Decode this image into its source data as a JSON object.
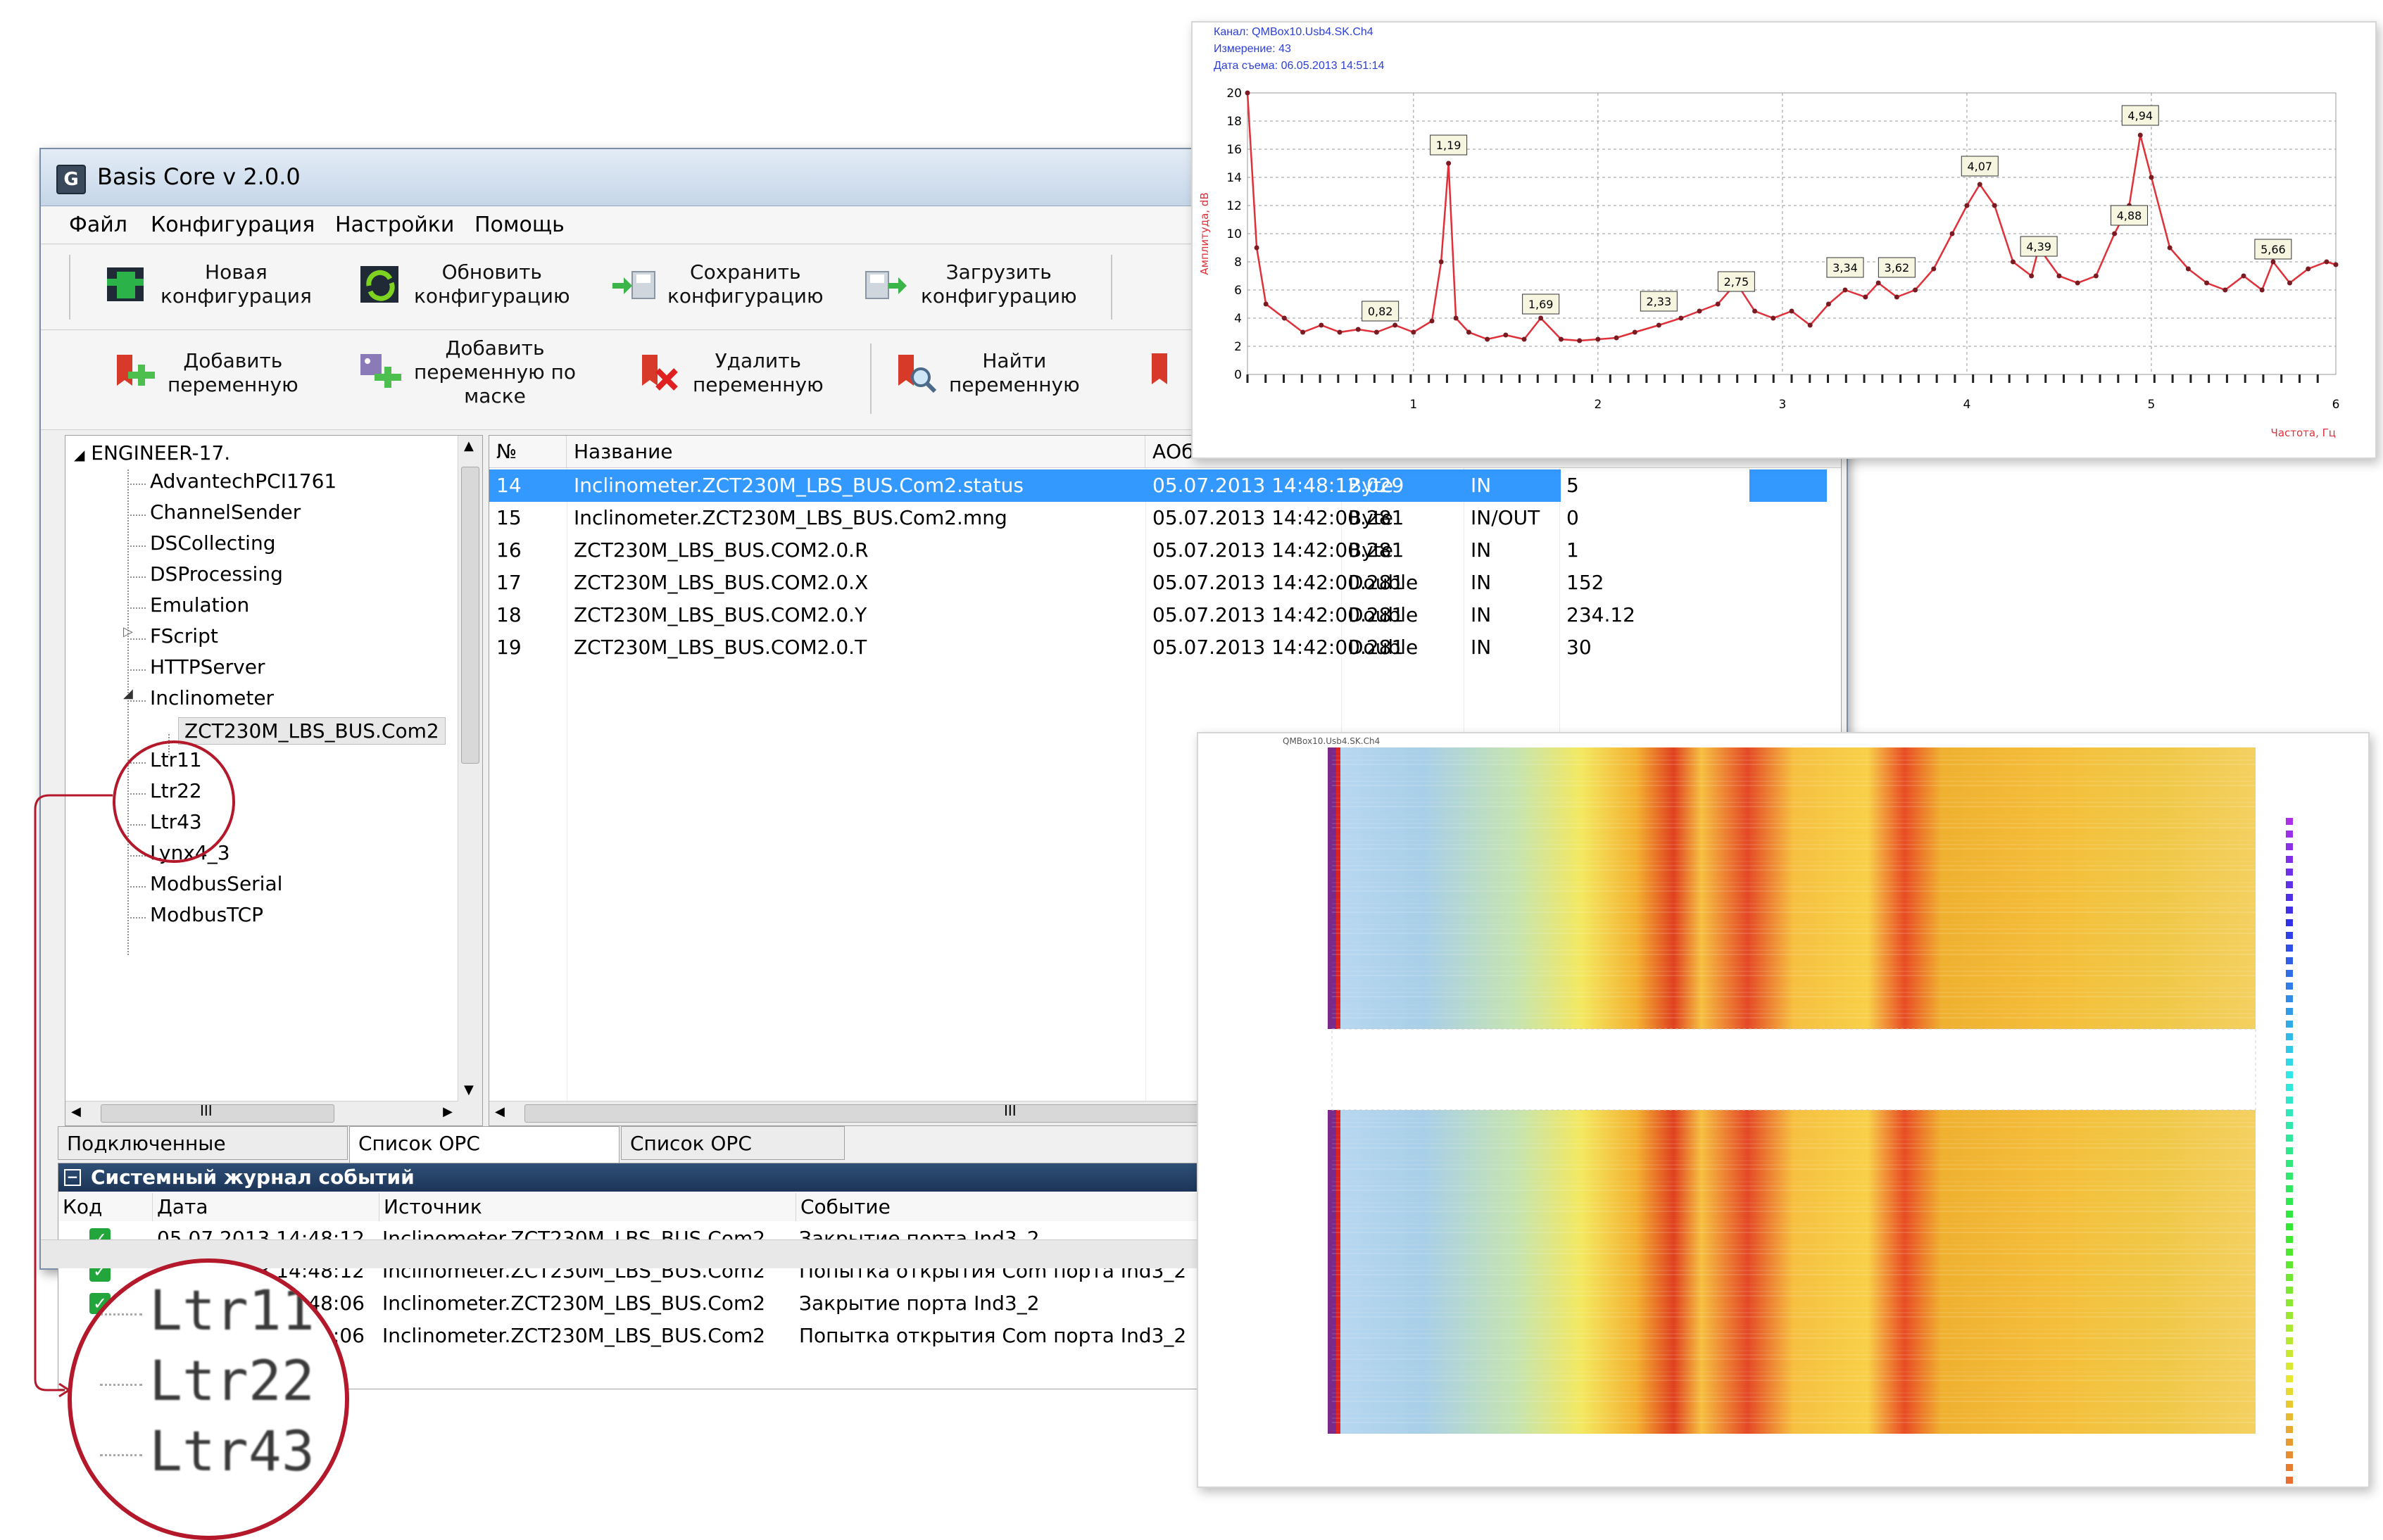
{
  "window": {
    "title": "Basis Core v 2.0.0",
    "icon_letter": "G"
  },
  "menu": [
    "Файл",
    "Конфигурация",
    "Настройки",
    "Помощь"
  ],
  "toolbar1": [
    {
      "label": "Новая\nконфигурация",
      "icon": "new-config-icon"
    },
    {
      "label": "Обновить\nконфигурацию",
      "icon": "refresh-config-icon"
    },
    {
      "label": "Сохранить\nконфигурацию",
      "icon": "save-config-icon"
    },
    {
      "label": "Загрузить\nконфигурацию",
      "icon": "load-config-icon"
    }
  ],
  "toolbar2": [
    {
      "label": "Добавить\nпеременную",
      "icon": "add-variable-icon"
    },
    {
      "label": "Добавить\nпеременную по\nмаске",
      "icon": "add-variable-mask-icon"
    },
    {
      "label": "Удалить\nпеременную",
      "icon": "delete-variable-icon"
    },
    {
      "label": "Найти\nпеременную",
      "icon": "find-variable-icon"
    }
  ],
  "tree": {
    "root": "ENGINEER-17.",
    "items": [
      "AdvantechPCI1761",
      "ChannelSender",
      "DSCollecting",
      "DSProcessing",
      "Emulation",
      "FScript",
      "HTTPServer",
      "Inclinometer",
      "Ltr11",
      "Ltr22",
      "Ltr43",
      "Lynx4_3",
      "ModbusSerial",
      "ModbusTCP"
    ],
    "selected_child": "ZCT230M_LBS_BUS.Com2",
    "hscroll_label": "III"
  },
  "grid": {
    "headers": [
      "№",
      "Название",
      "АОб"
    ],
    "rows": [
      {
        "n": "14",
        "name": "Inclinometer.ZCT230M_LBS_BUS.Com2.status",
        "date": "05.07.2013 14:48:12.029",
        "type": "Byte",
        "dir": "IN",
        "val": "5"
      },
      {
        "n": "15",
        "name": "Inclinometer.ZCT230M_LBS_BUS.Com2.mng",
        "date": "05.07.2013 14:42:00.281",
        "type": "Byte",
        "dir": "IN/OUT",
        "val": "0"
      },
      {
        "n": "16",
        "name": "ZCT230M_LBS_BUS.COM2.0.R",
        "date": "05.07.2013 14:42:00.281",
        "type": "Byte",
        "dir": "IN",
        "val": "1"
      },
      {
        "n": "17",
        "name": "ZCT230M_LBS_BUS.COM2.0.X",
        "date": "05.07.2013 14:42:00.281",
        "type": "Double",
        "dir": "IN",
        "val": "152"
      },
      {
        "n": "18",
        "name": "ZCT230M_LBS_BUS.COM2.0.Y",
        "date": "05.07.2013 14:42:00.281",
        "type": "Double",
        "dir": "IN",
        "val": "234.12"
      },
      {
        "n": "19",
        "name": "ZCT230M_LBS_BUS.COM2.0.T",
        "date": "05.07.2013 14:42:00.281",
        "type": "Double",
        "dir": "IN",
        "val": "30"
      }
    ],
    "hscroll_label": "III"
  },
  "tabs": [
    "Подключенные устройства",
    "Список ОРС переменных",
    "Список ОРС клиентов"
  ],
  "log": {
    "title": "Системный журнал событий",
    "headers": [
      "Код",
      "Дата",
      "Источник",
      "Событие"
    ],
    "rows": [
      {
        "date": "05.07.2013 14:48:12",
        "source": "Inclinometer.ZCT230M_LBS_BUS.Com2",
        "event": "Закрытие порта Ind3_2"
      },
      {
        "date": "05.07.2013 14:48:12",
        "source": "Inclinometer.ZCT230M_LBS_BUS.Com2",
        "event": "Попытка открытия Com порта Ind3_2"
      },
      {
        "date": "05.07.2013 14:48:06",
        "source": "Inclinometer.ZCT230M_LBS_BUS.Com2",
        "event": "Закрытие порта Ind3_2"
      },
      {
        "date": "05.07.2013 14:48:06",
        "source": "Inclinometer.ZCT230M_LBS_BUS.Com2",
        "event": "Попытка открытия Com порта Ind3_2"
      }
    ]
  },
  "zoom": {
    "items": [
      "Ltr11",
      "Ltr22",
      "Ltr43"
    ]
  },
  "chart_data": {
    "type": "line",
    "header": [
      "Канал: QMBox10.Usb4.SK.Ch4",
      "Измерение: 43",
      "Дата съема: 06.05.2013 14:51:14"
    ],
    "ylabel": "Амплитуда, dB",
    "xlabel": "Частота, Гц",
    "xlim": [
      0.1,
      6
    ],
    "ylim": [
      0,
      20
    ],
    "xticks": [
      1,
      2,
      3,
      4,
      5,
      6
    ],
    "yticks": [
      0,
      2,
      4,
      6,
      8,
      10,
      12,
      14,
      16,
      18,
      20
    ],
    "color": "#e0303a",
    "x": [
      0.1,
      0.15,
      0.2,
      0.3,
      0.4,
      0.5,
      0.6,
      0.7,
      0.8,
      0.9,
      1.0,
      1.1,
      1.15,
      1.19,
      1.23,
      1.3,
      1.4,
      1.5,
      1.6,
      1.69,
      1.8,
      1.9,
      2.0,
      2.1,
      2.2,
      2.33,
      2.45,
      2.55,
      2.65,
      2.75,
      2.85,
      2.95,
      3.05,
      3.15,
      3.25,
      3.34,
      3.45,
      3.52,
      3.62,
      3.72,
      3.82,
      3.92,
      4.0,
      4.07,
      4.15,
      4.25,
      4.35,
      4.39,
      4.5,
      4.6,
      4.7,
      4.8,
      4.88,
      4.94,
      5.0,
      5.1,
      5.2,
      5.3,
      5.4,
      5.5,
      5.6,
      5.66,
      5.75,
      5.85,
      5.95,
      6.0
    ],
    "values": [
      20,
      9,
      5,
      4,
      3,
      3.5,
      3,
      3.2,
      3,
      3.5,
      3,
      3.8,
      8,
      15,
      4,
      3,
      2.5,
      2.8,
      2.5,
      4,
      2.5,
      2.4,
      2.5,
      2.6,
      3,
      3.5,
      4,
      4.5,
      5,
      6.5,
      4.5,
      4,
      4.5,
      3.5,
      5,
      6,
      5.5,
      6.5,
      5.5,
      6,
      7.5,
      10,
      12,
      13.5,
      12,
      8,
      7,
      9,
      7,
      6.5,
      7,
      10,
      12,
      17,
      14,
      9,
      7.5,
      6.5,
      6,
      7,
      6,
      8,
      6.5,
      7.5,
      8,
      7.8
    ],
    "annotations": [
      {
        "x": 0.82,
        "y": 4.5,
        "text": "0,82"
      },
      {
        "x": 1.19,
        "y": 16.3,
        "text": "1,19"
      },
      {
        "x": 1.69,
        "y": 5.0,
        "text": "1,69"
      },
      {
        "x": 2.33,
        "y": 5.2,
        "text": "2,33"
      },
      {
        "x": 2.75,
        "y": 6.6,
        "text": "2,75"
      },
      {
        "x": 3.34,
        "y": 7.6,
        "text": "3,34"
      },
      {
        "x": 3.62,
        "y": 7.6,
        "text": "3,62"
      },
      {
        "x": 4.07,
        "y": 14.8,
        "text": "4,07"
      },
      {
        "x": 4.39,
        "y": 9.1,
        "text": "4,39"
      },
      {
        "x": 4.88,
        "y": 11.3,
        "text": "4,88"
      },
      {
        "x": 4.94,
        "y": 18.4,
        "text": "4,94"
      },
      {
        "x": 5.66,
        "y": 8.9,
        "text": "5,66"
      }
    ]
  },
  "spectrogram": {
    "title": "QMBox10.Usb4.SK.Ch4"
  }
}
